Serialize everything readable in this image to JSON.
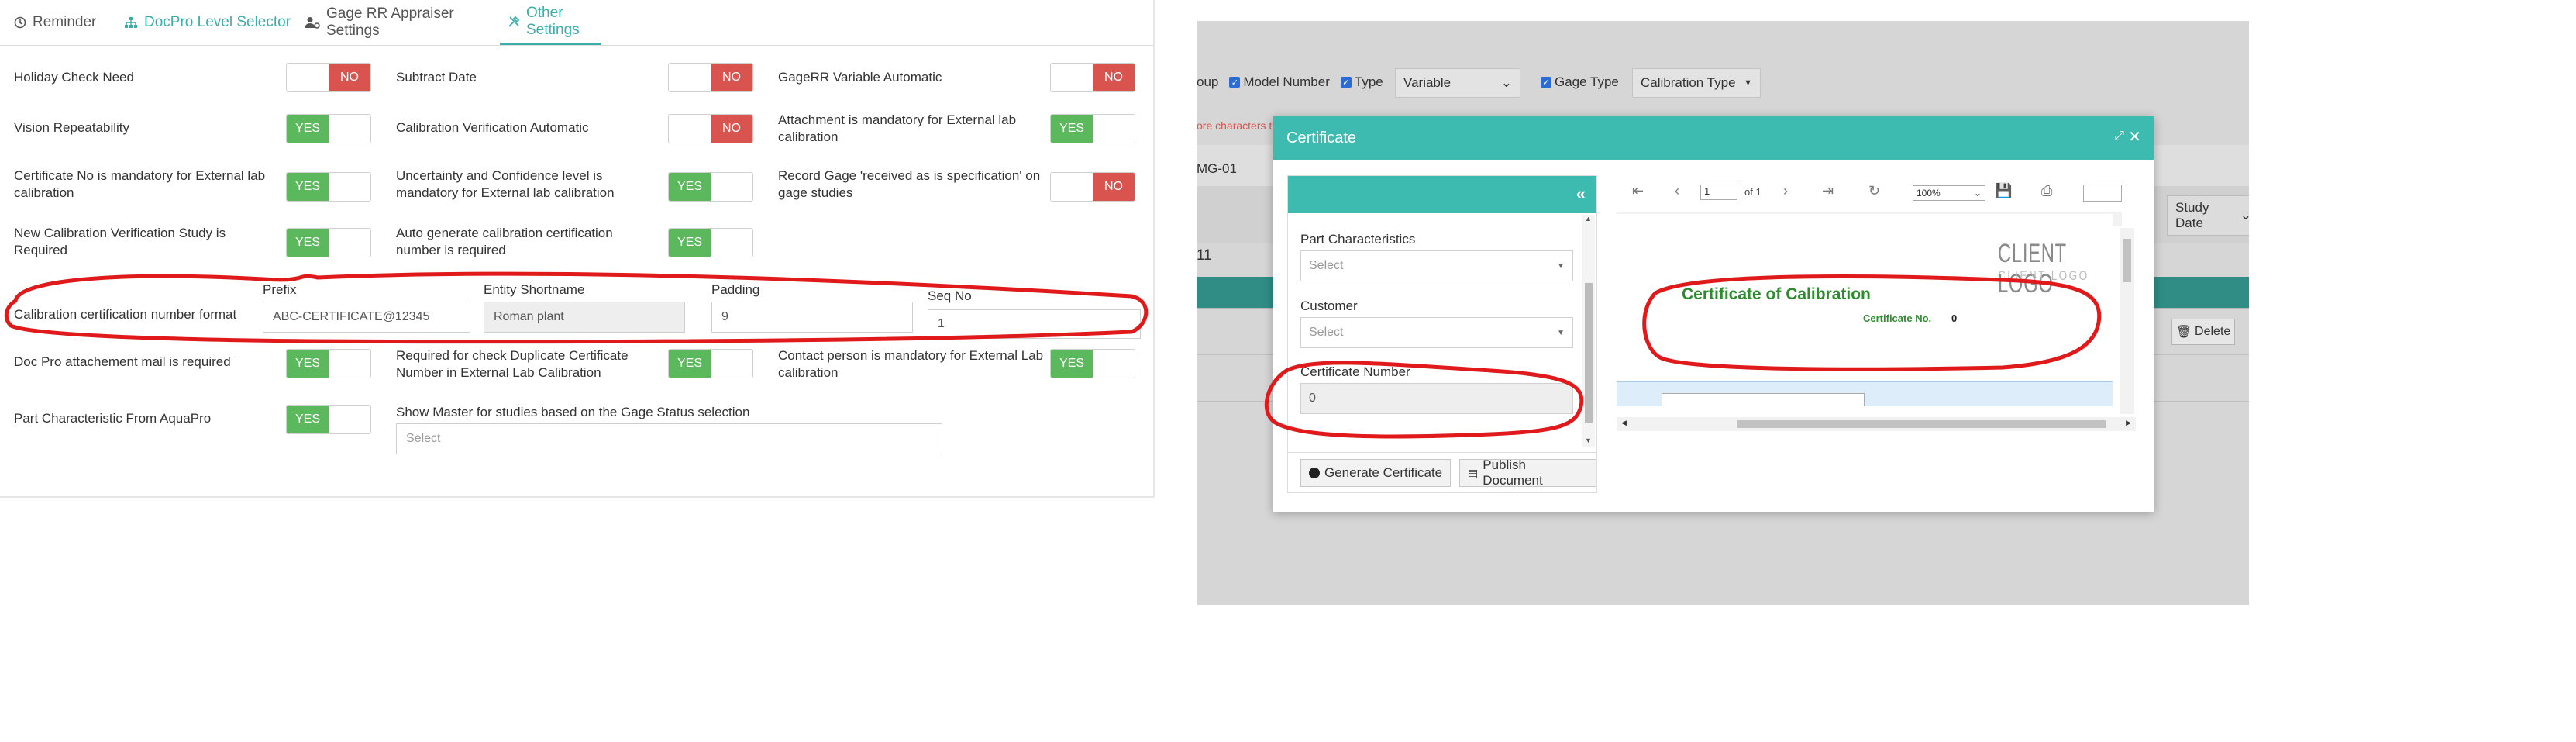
{
  "tabs": [
    {
      "label": "Reminder",
      "icon": "clock-icon",
      "active": false
    },
    {
      "label": "DocPro Level Selector",
      "icon": "sitemap-icon",
      "active": false
    },
    {
      "label": "Gage RR Appraiser Settings",
      "icon": "user-gear-icon",
      "active": false
    },
    {
      "label": "Other Settings",
      "icon": "tools-icon",
      "active": true
    }
  ],
  "toggle_text": {
    "yes": "YES",
    "no": "NO"
  },
  "settings": {
    "holiday_check": {
      "label": "Holiday Check Need",
      "value": "NO"
    },
    "subtract_date": {
      "label": "Subtract Date",
      "value": "NO"
    },
    "gagerr_variable": {
      "label": "GageRR Variable Automatic",
      "value": "NO"
    },
    "vision_repeat": {
      "label": "Vision Repeatability",
      "value": "YES"
    },
    "cal_verif_auto": {
      "label": "Calibration Verification Automatic",
      "value": "NO"
    },
    "attachment_mandatory": {
      "label": "Attachment is mandatory for External lab calibration",
      "value": "YES"
    },
    "cert_no_mandatory": {
      "label": "Certificate No is mandatory for External lab calibration",
      "value": "YES"
    },
    "uncertainty": {
      "label": "Uncertainty and Confidence level is mandatory for External lab calibration",
      "value": "YES"
    },
    "record_gage": {
      "label": "Record Gage 'received as is specification' on gage studies",
      "value": "NO"
    },
    "new_cal_verif": {
      "label": "New Calibration Verification Study is Required",
      "value": "YES"
    },
    "auto_gen_cert": {
      "label": "Auto generate calibration certification number is required",
      "value": "YES"
    },
    "docpro_mail": {
      "label": "Doc Pro attachement mail is required",
      "value": "YES"
    },
    "dup_cert_check": {
      "label": "Required for check Duplicate Certificate Number in External Lab Calibration",
      "value": "YES"
    },
    "contact_person": {
      "label": "Contact person is mandatory for External Lab calibration",
      "value": "YES"
    },
    "part_char_aquapro": {
      "label": "Part Characteristic From AquaPro",
      "value": "YES"
    },
    "show_master": {
      "label": "Show Master for studies based on the Gage Status selection",
      "placeholder": "Select"
    }
  },
  "cert_format": {
    "label": "Calibration certification number format",
    "prefix_label": "Prefix",
    "prefix_value": "ABC-CERTIFICATE@12345",
    "entity_label": "Entity Shortname",
    "entity_value": "Roman plant",
    "padding_label": "Padding",
    "padding_value": "9",
    "seq_label": "Seq No",
    "seq_value": "1"
  },
  "background_app": {
    "group_fragment": "oup",
    "model_number": "Model Number",
    "type": "Type",
    "type_select": "Variable",
    "gage_type": "Gage Type",
    "calibration_type": "Calibration Type",
    "error_fragment": "ore characters t",
    "mg_fragment": "MG-01",
    "num_fragment": "11",
    "study_date": "Study Date",
    "delete": "Delete"
  },
  "modal": {
    "title": "Certificate",
    "part_char_label": "Part Characteristics",
    "part_char_placeholder": "Select",
    "customer_label": "Customer",
    "customer_placeholder": "Select",
    "cert_number_label": "Certificate Number",
    "cert_number_value": "0",
    "generate_btn": "Generate Certificate",
    "publish_btn": "Publish Document",
    "viewer": {
      "page_value": "1",
      "page_of": "of 1",
      "zoom": "100%"
    },
    "document": {
      "logo_main": "CLIENT LOGO",
      "logo_sub": "CLIENT LOGO",
      "heading": "Certificate of Calibration",
      "cert_no_label": "Certificate No.",
      "cert_no_value": "0"
    }
  },
  "colors": {
    "accent": "#3aafa9",
    "yes": "#5cb85c",
    "no": "#d9534f",
    "annotation": "#e0191b",
    "cert_heading": "#2e8b2e"
  }
}
